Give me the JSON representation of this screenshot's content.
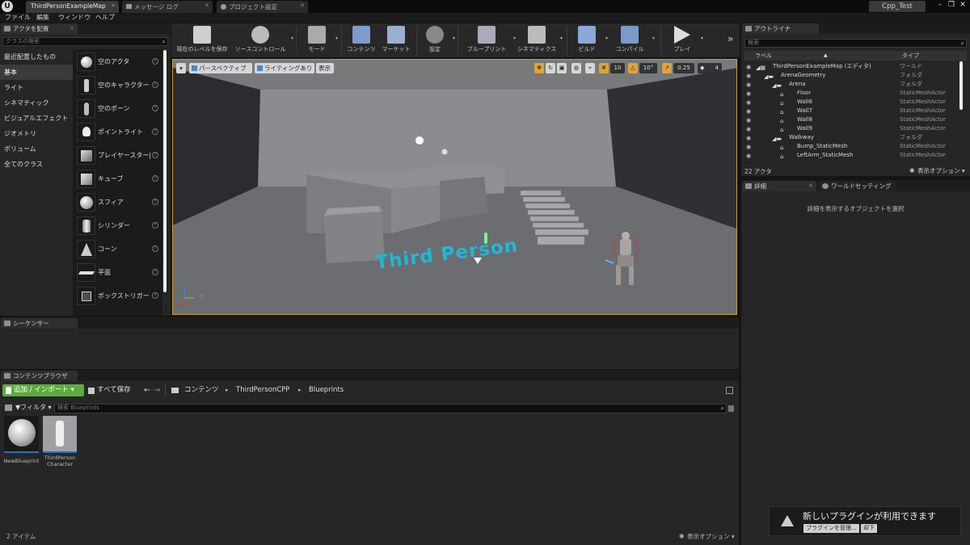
{
  "title_bar": {
    "logo": "U",
    "doc_tabs": [
      "ThirdPersonExampleMap",
      "メッセージ ログ",
      "プロジェクト設定"
    ],
    "project_name": "Cpp_Test",
    "window_buttons": [
      "–",
      "❐",
      "✕"
    ]
  },
  "menu": [
    "ファイル",
    "編集",
    "ウィンドウ",
    "ヘルプ"
  ],
  "place_actors": {
    "tab_label": "アクタを配置",
    "search_placeholder": "クラスの検索",
    "categories": [
      "最近配置したもの",
      "基本",
      "ライト",
      "シネマティック",
      "ビジュアルエフェクト",
      "ジオメトリ",
      "ボリューム",
      "全てのクラス"
    ],
    "selected_category": "基本",
    "items": [
      "空のアクタ",
      "空のキャラクター",
      "空のポーン",
      "ポイントライト",
      "プレイヤースター|",
      "キューブ",
      "スフィア",
      "シリンダー",
      "コーン",
      "平面",
      "ボックストリガー"
    ],
    "help_glyph": "?"
  },
  "toolbar": {
    "buttons": [
      "現在のレベルを保存",
      "ソースコントロール",
      "モード",
      "コンテンツ",
      "マーケット",
      "設定",
      "ブループリント",
      "シネマティクス",
      "ビルド",
      "コンパイル",
      "プレイ"
    ],
    "overflow": "»"
  },
  "viewport": {
    "perspective_label": "パースペクティブ",
    "lighting_label": "ライティングあり",
    "show_label": "表示",
    "grid_snap_value": "10",
    "rotate_snap_value": "10°",
    "scale_snap_value": "0.25",
    "camera_speed_value": "4",
    "floor_text": "Third Person"
  },
  "sequencer": {
    "tab_label": "シーケンサー"
  },
  "content_browser": {
    "tab_label": "コンテンツブラウザ",
    "add_import_label": "追加 / インポート",
    "save_all_label": "すべて保存",
    "path": [
      "コンテンツ",
      "ThirdPersonCPP",
      "Blueprints"
    ],
    "filter_label": "フィルタ",
    "search_placeholder": "検索 Blueprints",
    "assets": [
      {
        "name": "NewBlueprint"
      },
      {
        "name": "ThirdPerson Character"
      }
    ],
    "item_count": "2 アイテム",
    "view_options_label": "表示オプション"
  },
  "outliner": {
    "tab_label": "アウトライナ",
    "search_placeholder": "検索",
    "col_label": "ラベル",
    "col_type": "タイプ",
    "rows": [
      {
        "label": "ThirdPersonExampleMap (エディタ)",
        "type": "ワールド",
        "depth": 0
      },
      {
        "label": "ArenaGeometry",
        "type": "フォルダ",
        "depth": 1
      },
      {
        "label": "Arena",
        "type": "フォルダ",
        "depth": 2
      },
      {
        "label": "Floor",
        "type": "StaticMeshActor",
        "depth": 3
      },
      {
        "label": "Wall6",
        "type": "StaticMeshActor",
        "depth": 3
      },
      {
        "label": "Wall7",
        "type": "StaticMeshActor",
        "depth": 3
      },
      {
        "label": "Wall8",
        "type": "StaticMeshActor",
        "depth": 3
      },
      {
        "label": "Wall9",
        "type": "StaticMeshActor",
        "depth": 3
      },
      {
        "label": "Walkway",
        "type": "フォルダ",
        "depth": 2
      },
      {
        "label": "Bump_StaticMesh",
        "type": "StaticMeshActor",
        "depth": 3
      },
      {
        "label": "LeftArm_StaticMesh",
        "type": "StaticMeshActor",
        "depth": 3
      }
    ],
    "actor_count": "22 アクタ",
    "view_options_label": "表示オプション"
  },
  "details": {
    "tab_details": "詳細",
    "tab_world_settings": "ワールドセッティング",
    "empty_message": "詳細を表示するオブジェクトを選択"
  },
  "notification": {
    "message": "新しいプラグインが利用できます",
    "manage_label": "プラグインを管理...",
    "dismiss_label": "却下"
  },
  "colors": {
    "accent_gold": "#c89d2e",
    "add_green": "#5cab3e",
    "floor_text": "#1fb8d6"
  }
}
